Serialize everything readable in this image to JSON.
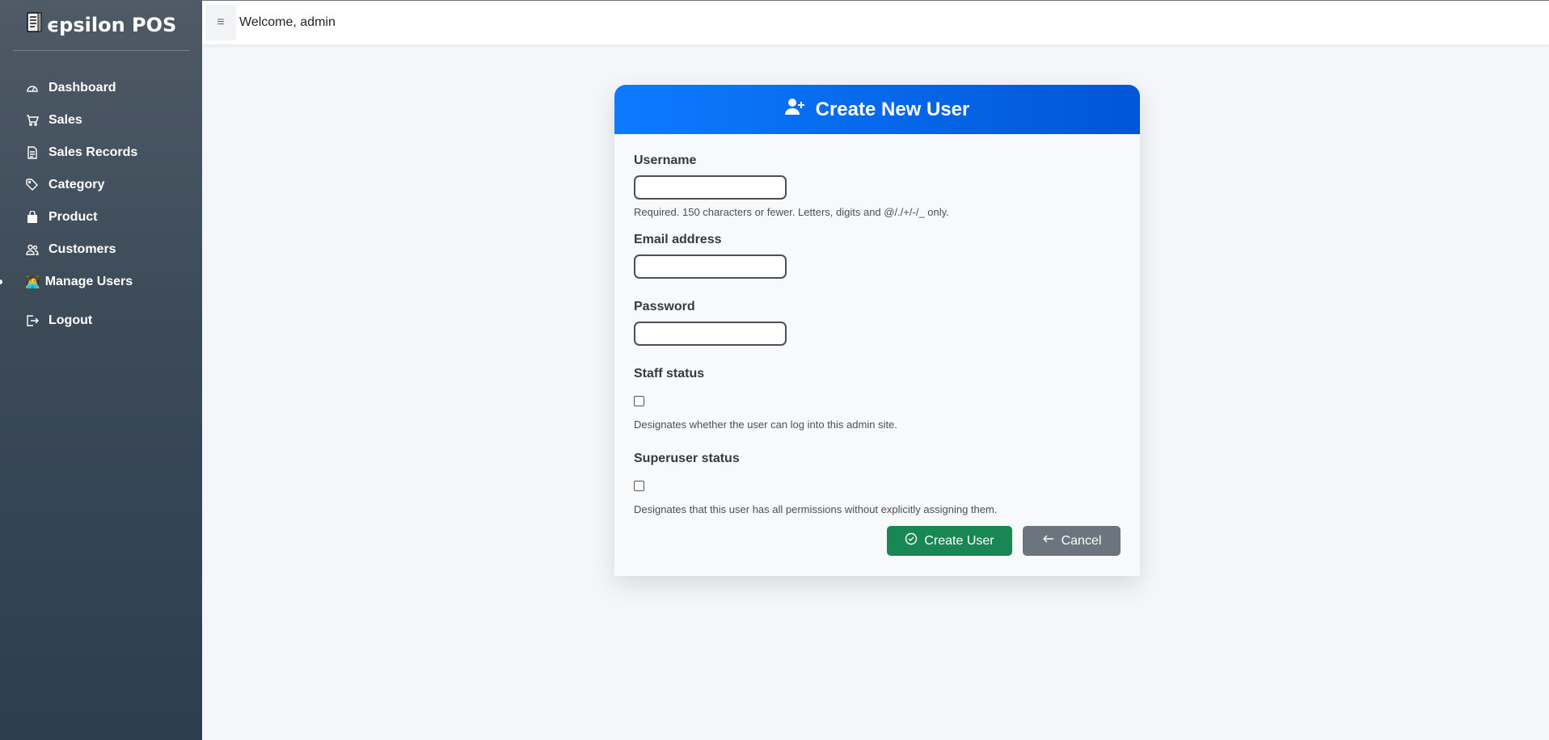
{
  "brand": {
    "icon": "receipt-icon",
    "name": "ϵpsilon POS"
  },
  "sidebar": {
    "items": [
      {
        "label": "Dashboard",
        "icon": "speedometer-icon"
      },
      {
        "label": "Sales",
        "icon": "cart-icon"
      },
      {
        "label": "Sales Records",
        "icon": "document-icon"
      },
      {
        "label": "Category",
        "icon": "tags-icon"
      },
      {
        "label": "Product",
        "icon": "bag-icon"
      },
      {
        "label": "Customers",
        "icon": "people-icon"
      },
      {
        "label": "Manage Users",
        "icon": "technologist-emoji",
        "emoji": "🧑‍💻",
        "active": true
      },
      {
        "label": "Logout",
        "icon": "logout-icon"
      }
    ]
  },
  "topbar": {
    "toggle_icon": "hamburger-icon",
    "welcome": "Welcome, admin"
  },
  "form": {
    "title": "Create New User",
    "title_icon": "user-plus-icon",
    "fields": {
      "username": {
        "label": "Username",
        "value": "",
        "help": "Required. 150 characters or fewer. Letters, digits and @/./+/-/_ only."
      },
      "email": {
        "label": "Email address",
        "value": ""
      },
      "password": {
        "label": "Password",
        "value": ""
      },
      "staff": {
        "label": "Staff status",
        "checked": false,
        "help": "Designates whether the user can log into this admin site."
      },
      "superuser": {
        "label": "Superuser status",
        "checked": false,
        "help": "Designates that this user has all permissions without explicitly assigning them."
      }
    },
    "buttons": {
      "create": "Create User",
      "cancel": "Cancel"
    }
  },
  "colors": {
    "primary": "#0d6efd",
    "success": "#198754",
    "secondary": "#6c757d",
    "sidebar_top": "#4e5a66",
    "sidebar_bottom": "#2c3e50"
  }
}
